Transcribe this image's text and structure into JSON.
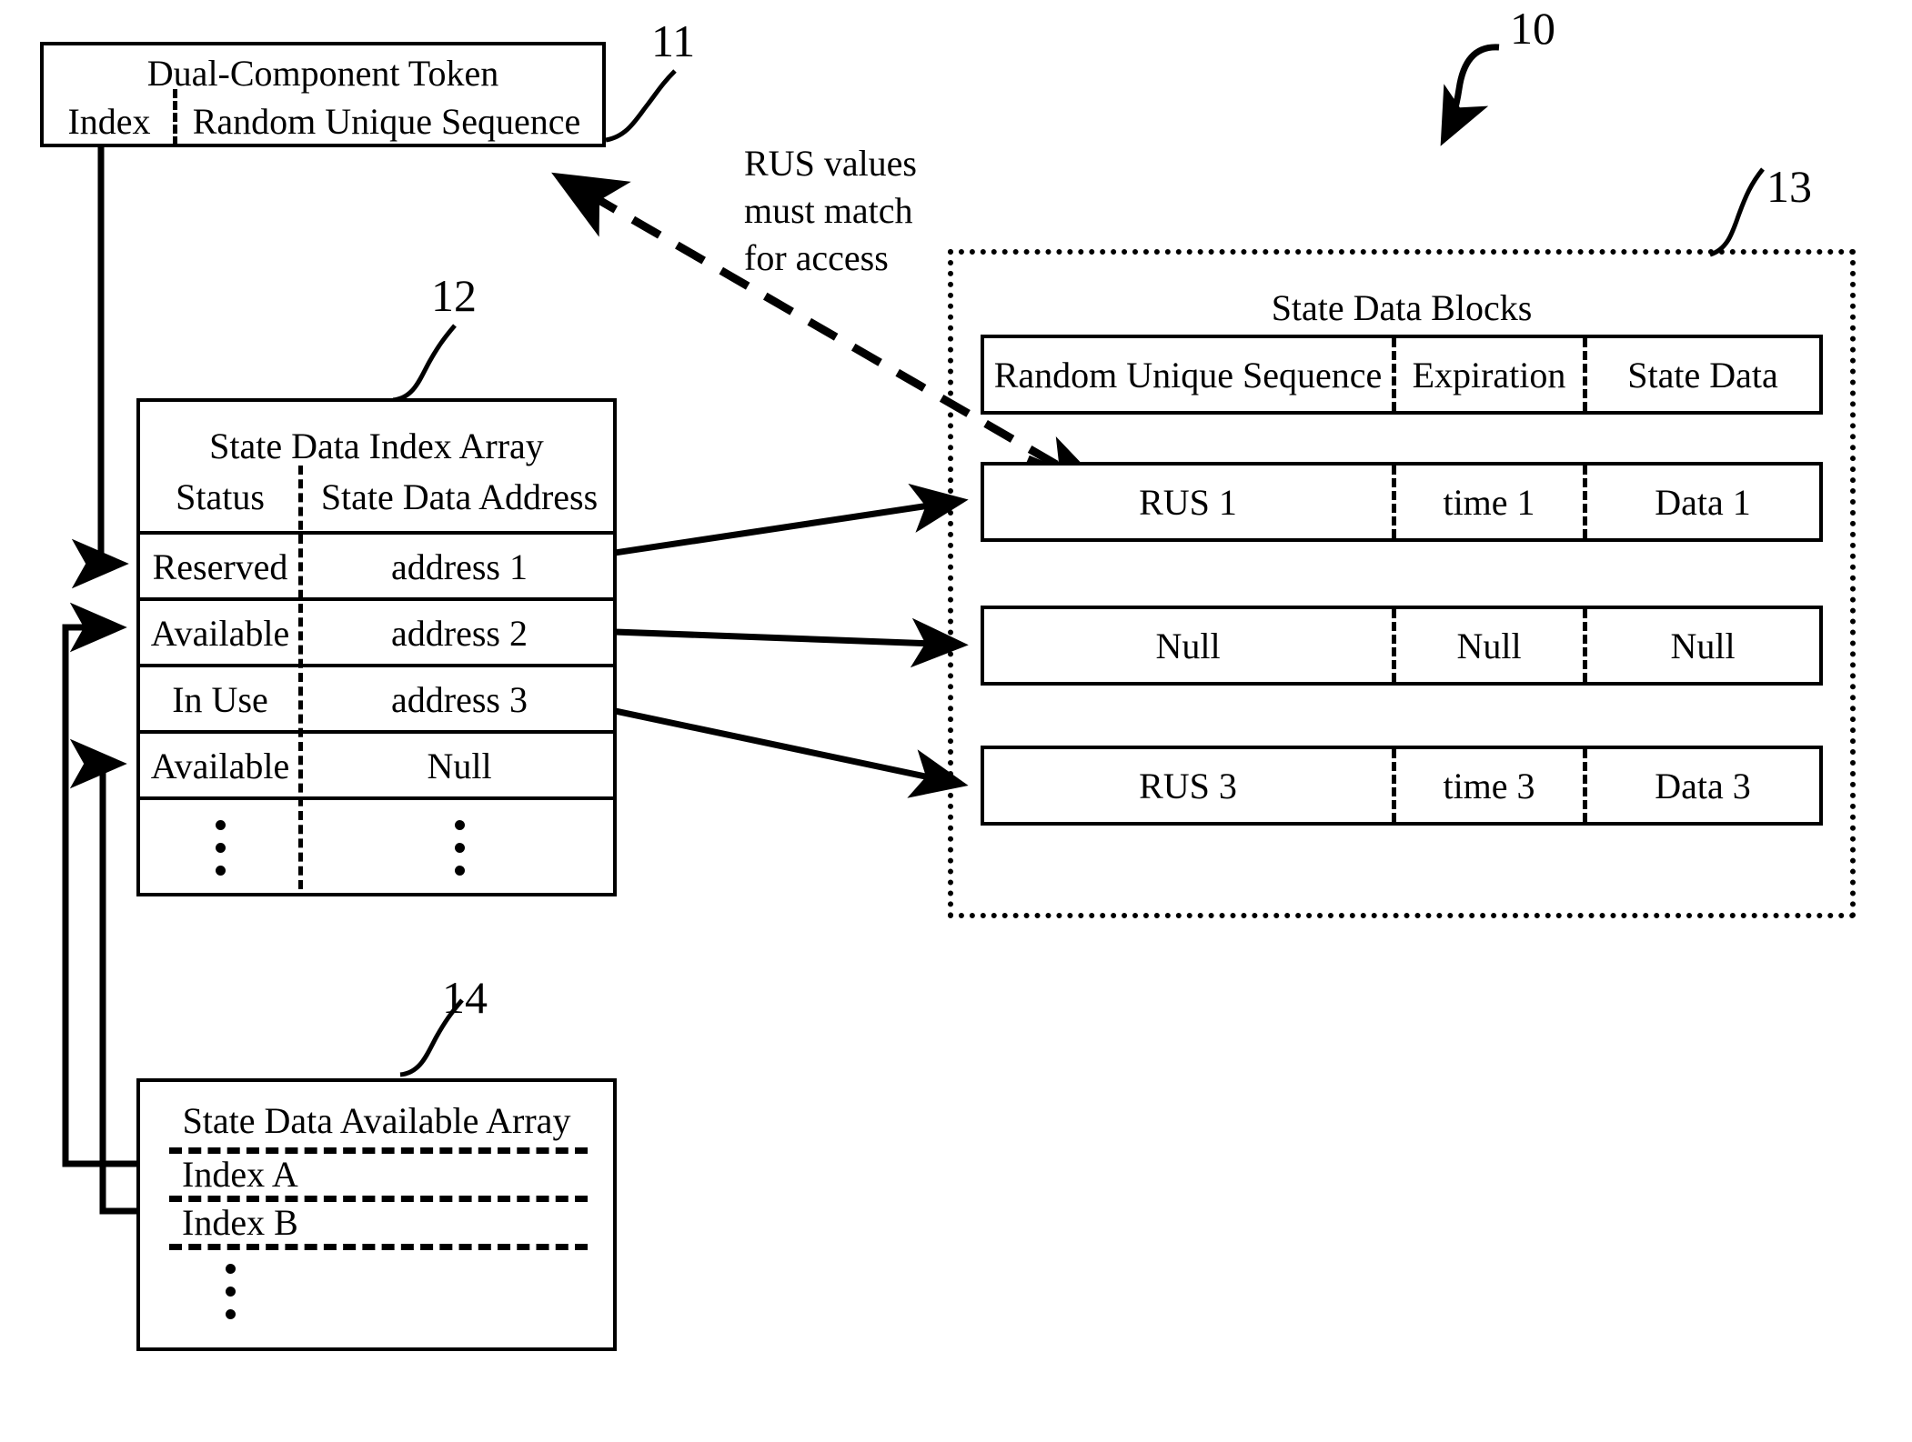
{
  "figure": {
    "overall_ref": "10",
    "token": {
      "ref": "11",
      "title": "Dual-Component Token",
      "fields": [
        "Index",
        "Random Unique Sequence"
      ]
    },
    "index_array": {
      "ref": "12",
      "title": "State Data Index Array",
      "columns": [
        "Status",
        "State Data Address"
      ],
      "rows": [
        {
          "status": "Reserved",
          "address": "address 1"
        },
        {
          "status": "Available",
          "address": "address 2"
        },
        {
          "status": "In Use",
          "address": "address 3"
        },
        {
          "status": "Available",
          "address": "Null"
        },
        {
          "status": "⋮",
          "address": "⋮"
        }
      ]
    },
    "state_data_blocks": {
      "ref": "13",
      "title": "State Data Blocks",
      "columns": [
        "Random Unique Sequence",
        "Expiration",
        "State Data"
      ],
      "rows": [
        {
          "rus": "RUS 1",
          "expiration": "time 1",
          "data": "Data 1"
        },
        {
          "rus": "Null",
          "expiration": "Null",
          "data": "Null"
        },
        {
          "rus": "RUS 3",
          "expiration": "time 3",
          "data": "Data 3"
        }
      ]
    },
    "available_array": {
      "ref": "14",
      "title": "State Data Available Array",
      "rows": [
        "Index A",
        "Index B",
        "⋮"
      ]
    },
    "annotation": {
      "line1": "RUS values",
      "line2": "must match",
      "line3": "for access"
    },
    "colors": {
      "ink": "#000000",
      "paper": "#ffffff"
    }
  }
}
